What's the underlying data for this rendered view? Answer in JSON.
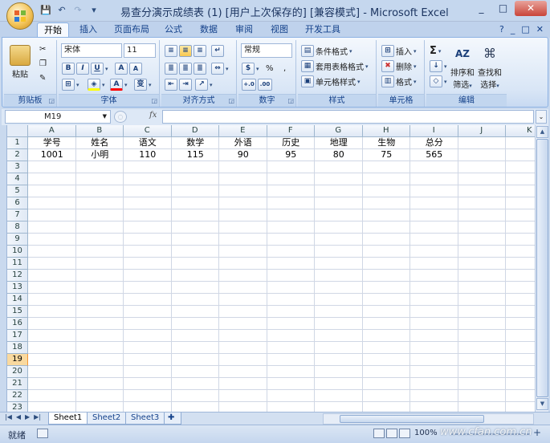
{
  "window": {
    "title": "易查分演示成绩表 (1) [用户上次保存的]  [兼容模式] - Microsoft Excel",
    "controls": [
      "_",
      "□",
      "✕"
    ]
  },
  "quick_access": {
    "save": "💾",
    "undo": "↶",
    "redo": "↷",
    "customize": "▾"
  },
  "tabs": [
    {
      "label": "开始",
      "active": true
    },
    {
      "label": "插入"
    },
    {
      "label": "页面布局"
    },
    {
      "label": "公式"
    },
    {
      "label": "数据"
    },
    {
      "label": "审阅"
    },
    {
      "label": "视图"
    },
    {
      "label": "开发工具"
    }
  ],
  "tabs_right": {
    "help": "?",
    "min": "_",
    "restore": "□",
    "close": "✕"
  },
  "ribbon": {
    "clipboard": {
      "label": "剪贴板",
      "paste": "粘贴"
    },
    "font": {
      "label": "字体",
      "name": "宋体",
      "size": "11",
      "bold": "B",
      "italic": "I",
      "underline": "U",
      "grow": "A",
      "shrink": "A",
      "wen": "变"
    },
    "alignment": {
      "label": "对齐方式"
    },
    "number": {
      "label": "数字",
      "format": "常规",
      "percent": "%",
      "comma": ",",
      "inc": "+.0",
      "dec": ".00"
    },
    "styles": {
      "label": "样式",
      "conditional": "条件格式",
      "table": "套用表格格式",
      "cell": "单元格样式"
    },
    "cells": {
      "label": "单元格",
      "insert": "插入",
      "delete": "删除",
      "format": "格式"
    },
    "editing": {
      "label": "编辑",
      "sum": "Σ",
      "sort": "排序和",
      "sort2": "筛选",
      "find": "查找和",
      "find2": "选择"
    }
  },
  "formula_bar": {
    "name_box": "M19",
    "fx": "fx"
  },
  "columns": [
    "A",
    "B",
    "C",
    "D",
    "E",
    "F",
    "G",
    "H",
    "I",
    "J",
    "K"
  ],
  "rows": [
    "1",
    "2",
    "3",
    "4",
    "5",
    "6",
    "7",
    "8",
    "9",
    "10",
    "11",
    "12",
    "13",
    "14",
    "15",
    "16",
    "17",
    "18",
    "19",
    "20",
    "21",
    "22",
    "23"
  ],
  "selected_row": "19",
  "cells": {
    "row1": [
      "学号",
      "姓名",
      "语文",
      "数学",
      "外语",
      "历史",
      "地理",
      "生物",
      "总分"
    ],
    "row2": [
      "1001",
      "小明",
      "110",
      "115",
      "90",
      "95",
      "80",
      "75",
      "565"
    ]
  },
  "sheets": [
    {
      "label": "Sheet1",
      "active": true
    },
    {
      "label": "Sheet2"
    },
    {
      "label": "Sheet3"
    }
  ],
  "status": {
    "mode": "就绪",
    "zoom": "100%",
    "minus": "−",
    "plus": "+"
  },
  "watermark": "www.cfan.com.cn"
}
